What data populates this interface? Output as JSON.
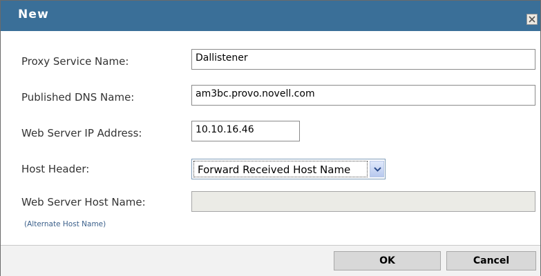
{
  "dialog": {
    "title": "New",
    "close_icon": "close-icon"
  },
  "form": {
    "proxy_service_name": {
      "label": "Proxy Service Name:",
      "value": "Dallistener"
    },
    "published_dns_name": {
      "label": "Published DNS Name:",
      "value": "am3bc.provo.novell.com"
    },
    "web_server_ip": {
      "label": "Web Server IP Address:",
      "value": "10.10.16.46"
    },
    "host_header": {
      "label": "Host Header:",
      "value": "Forward Received Host Name"
    },
    "web_server_host_name": {
      "label": "Web Server Host Name:",
      "value": "",
      "link": "(Alternate Host Name)"
    }
  },
  "buttons": {
    "ok": "OK",
    "cancel": "Cancel"
  },
  "colors": {
    "title_bar": "#3a6f98",
    "footer": "#f2f2f2"
  }
}
